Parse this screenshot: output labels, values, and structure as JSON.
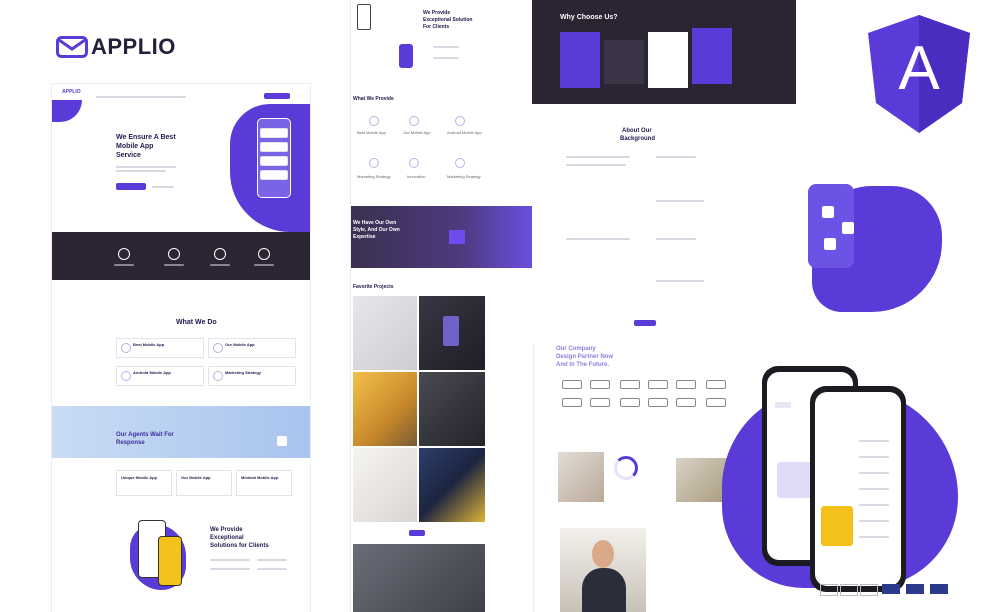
{
  "brand": {
    "name": "APPLIO",
    "badge_letter": "A",
    "accent": "#5b3bd8",
    "dark": "#2a2433"
  },
  "left_page": {
    "nav_logo": "APPLIO",
    "hero_title_1": "We Ensure A Best",
    "hero_title_2": "Mobile App",
    "hero_title_3": "Service",
    "stats_icons": [
      "counter-1",
      "counter-2",
      "counter-3",
      "counter-4"
    ],
    "what_we_do_title": "What We Do",
    "services": [
      "Best Mobile App",
      "Our Mobile App",
      "Android Mobile App",
      "Marketing Strategy"
    ],
    "agents_title_1": "Our Agents Wait For",
    "agents_title_2": "Response",
    "agent_cards": [
      "Unique Mobile App",
      "Our Mobile App",
      "Minimal Mobile App"
    ],
    "provide_title_1": "We Provide",
    "provide_title_2": "Exceptional",
    "provide_title_3": "Solutions for Clients"
  },
  "middle_page": {
    "top_title_1": "We Provide",
    "top_title_2": "Exceptional Solution",
    "top_title_3": "For Clients",
    "what_we_provide": "What We Provide",
    "provide_items": [
      "Best Mobile App",
      "Our Mobile App",
      "Android Mobile App",
      "Marketing Strategy",
      "Innovation",
      "Marketing Strategy"
    ],
    "banner_title_1": "We Have Our Own",
    "banner_title_2": "Style, And Our Own",
    "banner_title_3": "Expertise",
    "favorite_projects": "Favorite Projects"
  },
  "right_page": {
    "why_choose_us": "Why Choose Us?",
    "about_title_1": "About Our",
    "about_title_2": "Background",
    "company_title_1": "Our Company",
    "company_title_2": "Design Partner Now",
    "company_title_3": "And In The Future."
  }
}
